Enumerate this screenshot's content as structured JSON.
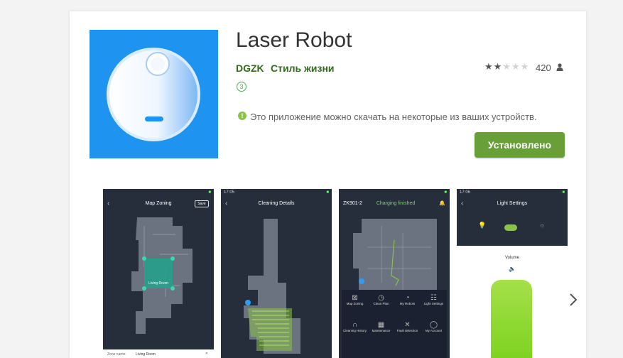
{
  "app": {
    "title": "Laser Robot",
    "developer": "DGZK",
    "category": "Стиль жизни",
    "content_rating": "3",
    "stars_filled": 2,
    "stars_total": 5,
    "ratings_count": "420",
    "compat_notice": "Это приложение можно скачать на некоторые из ваших устройств.",
    "install_label": "Установлено",
    "icon_bg": "#1f93f0",
    "install_color": "#689f38"
  },
  "screenshots": [
    {
      "status": "",
      "title": "Map Zoning",
      "save": "Save",
      "room": "Living Room",
      "zone_label": "Zone name:",
      "zone_value": "Living Room"
    },
    {
      "status": "17:05",
      "title": "Cleaning Details"
    },
    {
      "status": "",
      "title": "ZK901-2",
      "status_text": "Charging finished",
      "menu": [
        "Map Zoning",
        "Clean Plan",
        "My Robots",
        "Light Settings",
        "Cleaning History",
        "Maintenance",
        "Fault detection",
        "My Account"
      ]
    },
    {
      "status": "17:06",
      "title": "Light Settings",
      "volume_label": "Volume"
    }
  ]
}
